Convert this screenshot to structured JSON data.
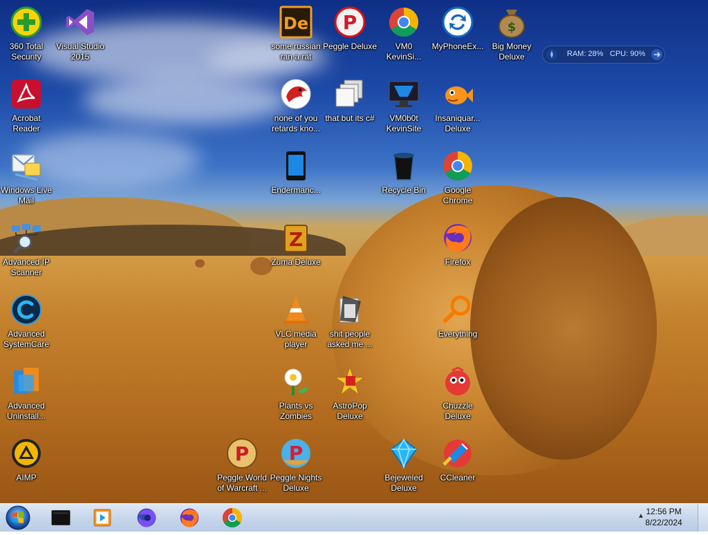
{
  "desktop": {
    "icons": [
      {
        "label": "360 Total\nSecurity",
        "icon": "360-security-icon"
      },
      {
        "label": "Visual Studio\n2015",
        "icon": "visual-studio-icon"
      },
      {
        "label": "Acrobat\nReader",
        "icon": "acrobat-icon"
      },
      {
        "label": "Windows Live\nMail",
        "icon": "windows-live-mail-icon"
      },
      {
        "label": "Advanced IP\nScanner",
        "icon": "ip-scanner-icon"
      },
      {
        "label": "Advanced\nSystemCare",
        "icon": "systemcare-icon"
      },
      {
        "label": "Advanced\nUninstall...",
        "icon": "uninstaller-icon"
      },
      {
        "label": "AIMP",
        "icon": "aimp-icon"
      },
      {
        "label": "Peggle World\nof Warcraft ...",
        "icon": "peggle-wow-icon"
      },
      {
        "label": "Peggle Nights\nDeluxe",
        "icon": "peggle-nights-icon"
      },
      {
        "label": "some russian\nran a rat",
        "icon": "de-app-icon"
      },
      {
        "label": "none of you\nretards kno...",
        "icon": "red-dragon-icon"
      },
      {
        "label": "Endermanc...",
        "icon": "tablet-icon"
      },
      {
        "label": "Zuma Deluxe",
        "icon": "zuma-icon"
      },
      {
        "label": "VLC media\nplayer",
        "icon": "vlc-icon"
      },
      {
        "label": "Plants vs\nZombies",
        "icon": "pvz-icon"
      },
      {
        "label": "Peggle Deluxe",
        "icon": "peggle-icon"
      },
      {
        "label": "that but its c#",
        "icon": "shortcut-windows-icon"
      },
      {
        "label": "shit people\nasked me ...",
        "icon": "documents-icon"
      },
      {
        "label": "AstroPop\nDeluxe",
        "icon": "astropop-icon"
      },
      {
        "label": "VM0\nKevinSi...",
        "icon": "chrome-icon"
      },
      {
        "label": "VM0b0t\nKevinSite",
        "icon": "vm-monitor-icon"
      },
      {
        "label": "Recycle Bin",
        "icon": "recycle-bin-icon"
      },
      {
        "label": "Bejeweled\nDeluxe",
        "icon": "bejeweled-icon"
      },
      {
        "label": "MyPhoneEx...",
        "icon": "myphoneexplorer-icon"
      },
      {
        "label": "Insaniquar...\nDeluxe",
        "icon": "insaniquarium-icon"
      },
      {
        "label": "Google\nChrome",
        "icon": "chrome-icon"
      },
      {
        "label": "Firefox",
        "icon": "firefox-icon"
      },
      {
        "label": "Everything",
        "icon": "everything-search-icon"
      },
      {
        "label": "Chuzzle\nDeluxe",
        "icon": "chuzzle-icon"
      },
      {
        "label": "CCleaner",
        "icon": "ccleaner-icon"
      },
      {
        "label": "Big Money\nDeluxe",
        "icon": "money-bag-icon"
      }
    ]
  },
  "gadget": {
    "ram": "RAM: 28%",
    "cpu": "CPU: 90%"
  },
  "taskbar": {
    "pinned": [
      "terminal-icon",
      "media-player-icon",
      "firefox-nightly-icon",
      "firefox-icon",
      "chrome-icon"
    ],
    "clock_time": "12:56 PM",
    "clock_date": "8/22/2024"
  }
}
